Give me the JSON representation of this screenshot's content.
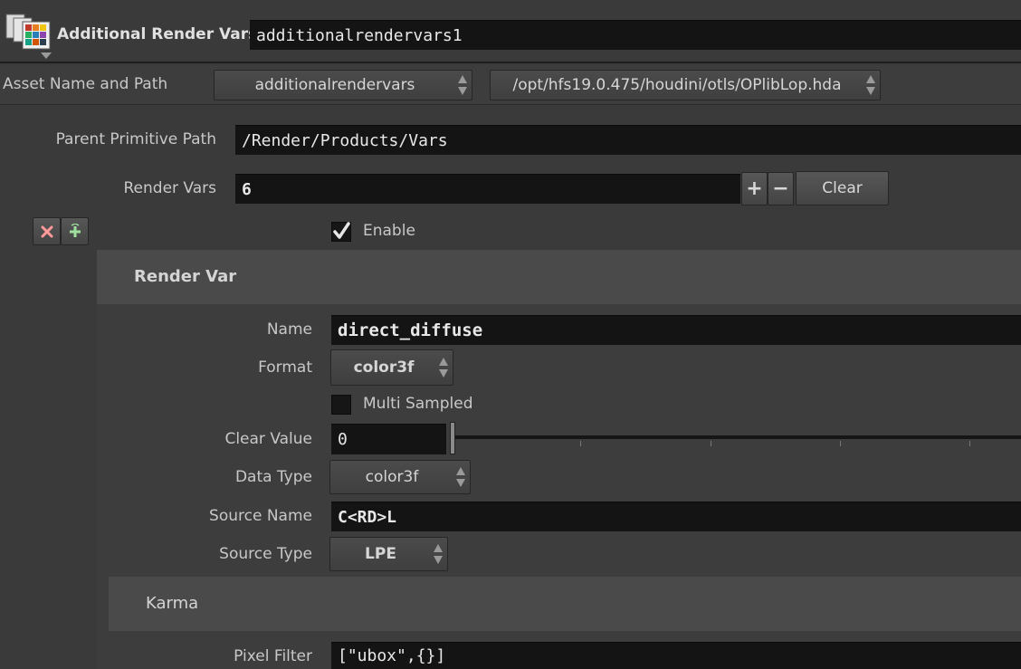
{
  "header": {
    "node_type_label": "Additional Render Vars",
    "node_name": "additionalrendervars1"
  },
  "asset": {
    "label": "Asset Name and Path",
    "name": "additionalrendervars",
    "path": "/opt/hfs19.0.475/houdini/otls/OPlibLop.hda"
  },
  "parent_path": {
    "label": "Parent Primitive Path",
    "value": "/Render/Products/Vars"
  },
  "render_vars": {
    "label": "Render Vars",
    "count": "6",
    "add_glyph": "+",
    "remove_glyph": "−",
    "clear_label": "Clear"
  },
  "instance": {
    "remove_icon": "close-icon",
    "insert_icon": "insert-icon",
    "enable_label": "Enable",
    "enabled": true
  },
  "render_var": {
    "title": "Render Var",
    "name_label": "Name",
    "name_value": "direct_diffuse",
    "format_label": "Format",
    "format_value": "color3f",
    "multi_sampled_label": "Multi Sampled",
    "multi_sampled": false,
    "clear_value_label": "Clear Value",
    "clear_value": "0",
    "data_type_label": "Data Type",
    "data_type_value": "color3f",
    "source_name_label": "Source Name",
    "source_name_value": "C<RD>L",
    "source_type_label": "Source Type",
    "source_type_value": "LPE"
  },
  "karma": {
    "title": "Karma",
    "pixel_filter_label": "Pixel Filter",
    "pixel_filter_value": "[\"ubox\",{}]"
  },
  "colors": {
    "background": "#3a3a3a",
    "field": "#141414",
    "section": "#474747"
  }
}
